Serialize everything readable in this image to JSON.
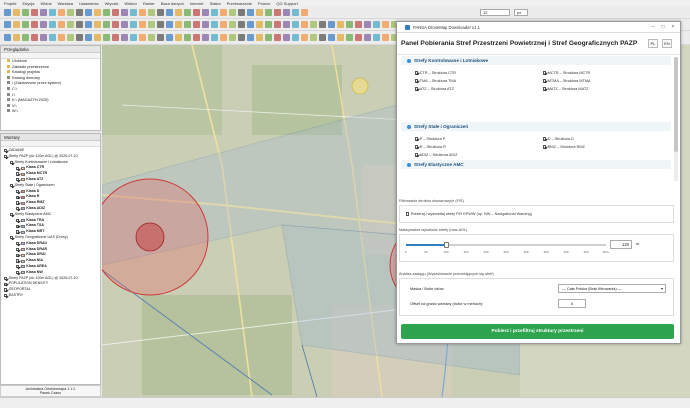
{
  "menu": [
    "Projekt",
    "Edycja",
    "Widok",
    "Warstwa",
    "Ustawienia",
    "Wtyczki",
    "Wektor",
    "Raster",
    "Baza danych",
    "Internet",
    "Siatka",
    "Przetwarzanie",
    "Pomoc",
    "QG Support"
  ],
  "toolbar": {
    "scale_value": "12",
    "scale_unit": "px"
  },
  "browser": {
    "title": "Przeglądarka",
    "items": [
      "Ulubione",
      "Zakładki przestrzenne",
      "Katalogi projektu",
      "Katalog domowy",
      "/ (Zastrzeżone przez system)",
      "C:\\",
      "I:\\",
      "K:\\ (MAGAZYN 2025)",
      "V:\\",
      "W:\\"
    ]
  },
  "layers": {
    "title": "Warstwy",
    "items": [
      {
        "label": "ZADANIE",
        "level": 0,
        "swatch": ""
      },
      {
        "label": "Strefy PAZP (do 120m AGL) @ 2026-07-10",
        "level": 0,
        "swatch": ""
      },
      {
        "label": "Strefy Kontrolowane i Lotniskowe",
        "level": 1,
        "swatch": ""
      },
      {
        "label": "Klasa CTR",
        "level": 2,
        "swatch": "#f5c07a"
      },
      {
        "label": "Klasa MCTR",
        "level": 2,
        "swatch": "#f2a36b"
      },
      {
        "label": "Klasa ATZ",
        "level": 2,
        "swatch": "#f8d98a"
      },
      {
        "label": "Strefy Stałe i Ograniczeń",
        "level": 1,
        "swatch": ""
      },
      {
        "label": "Klasa D",
        "level": 2,
        "swatch": "#e8867a"
      },
      {
        "label": "Klasa R",
        "level": 2,
        "swatch": "#e66b6b"
      },
      {
        "label": "Klasa RMZ",
        "level": 2,
        "swatch": "#ef9aa0"
      },
      {
        "label": "Klasa ADIZ",
        "level": 2,
        "swatch": "#c7a0d8"
      },
      {
        "label": "Strefy Elastyczne AMC",
        "level": 1,
        "swatch": ""
      },
      {
        "label": "Klasa TRA",
        "level": 2,
        "swatch": "#9fc2e6"
      },
      {
        "label": "Klasa TSA",
        "level": 2,
        "swatch": "#86aedc"
      },
      {
        "label": "Klasa MRT",
        "level": 2,
        "swatch": "#b0c7e0"
      },
      {
        "label": "Strefy Geograficzne UAS (Drony)",
        "level": 1,
        "swatch": ""
      },
      {
        "label": "Klasa DRAU",
        "level": 2,
        "swatch": "#d9a3e8"
      },
      {
        "label": "Klasa DRAR",
        "level": 2,
        "swatch": "#e7a6b4"
      },
      {
        "label": "Klasa DRAI",
        "level": 2,
        "swatch": "#f0c0a0"
      },
      {
        "label": "Klasa NIA",
        "level": 2,
        "swatch": "#b6d9a8"
      },
      {
        "label": "Klasa AREA",
        "level": 2,
        "swatch": "#a7c8e6"
      },
      {
        "label": "Klasa NW",
        "level": 2,
        "swatch": "#c0c0c0"
      },
      {
        "label": "Strefy PAZP (do 120m AGL) @ 2026-07-10",
        "level": 0,
        "swatch": ""
      },
      {
        "label": "POPULATION DENSITY",
        "level": 0,
        "swatch": ""
      },
      {
        "label": "GEOPORTAL",
        "level": 0,
        "swatch": ""
      },
      {
        "label": "RASTRY",
        "level": 0,
        "swatch": ""
      }
    ]
  },
  "status": {
    "left_text": "Archiwalna Ortofotomapa 1.1.2",
    "line2": "Pasek Czasu",
    "line3": "2026"
  },
  "dialog": {
    "window_title": "PANSA DroneMap Downloader v1.1",
    "heading": "Panel Pobierania Stref Przestrzeni Powietrznej i Stref Geograficznych PAZP",
    "lang_pl": "PL",
    "lang_en": "EN",
    "sections": [
      {
        "title": "Strefy Kontrolowane i Lotniskowe",
        "icon_color": "#3a8fd8",
        "left": [
          "CTR – Struktura CTR",
          "TMA – Struktura TMA",
          "ATZ – Struktura ATZ"
        ],
        "right": [
          "MCTR – Struktura MCTR",
          "MTMA – Struktura MTMA",
          "MATZ – Struktura MATZ"
        ]
      },
      {
        "title": "Strefy Stałe i Ograniczeń",
        "icon_color": "#3a8fd8",
        "left": [
          "P – Struktura P",
          "R – Struktura R",
          "ADIZ – Struktura ADIZ"
        ],
        "right": [
          "D – Struktura D",
          "RMZ – Struktura RMZ"
        ]
      },
      {
        "title": "Strefy Elastyczne AMC",
        "icon_color": "#3a8fd8",
        "left": [],
        "right": []
      }
    ],
    "filter_label": "Filtrowanie struktur obszarowych (FIS)",
    "filter_option": "Pobieraj i wyświetlaj strefy FIR EPWW (np. NW – Navigational Warning)",
    "height_label": "Maksymalna wysokość strefy (max AGL)",
    "height_value": "120",
    "height_unit": "m",
    "height_fraction": 0.2,
    "height_ticks": [
      "0",
      "50",
      "100",
      "150",
      "200",
      "250",
      "300",
      "350",
      "400",
      "450",
      "500+"
    ],
    "clip_label": "Analiza zasięgu (Wyszukiwanie przecinających się stref)",
    "mask_label": "Maska / Bufor lotów:",
    "mask_value": "— Cała Polska (Brak filtrowania) —",
    "offset_label": "Offset od granic warstwy (bufor w metrach):",
    "offset_value": "0",
    "button_label": "Pobierz i przefiltruj struktury przestrzeni"
  },
  "colors": {
    "accent": "#2ea44f",
    "section_text": "#1d4f7a",
    "restricted": "#d9534f",
    "corridor": "#3a78c4"
  }
}
